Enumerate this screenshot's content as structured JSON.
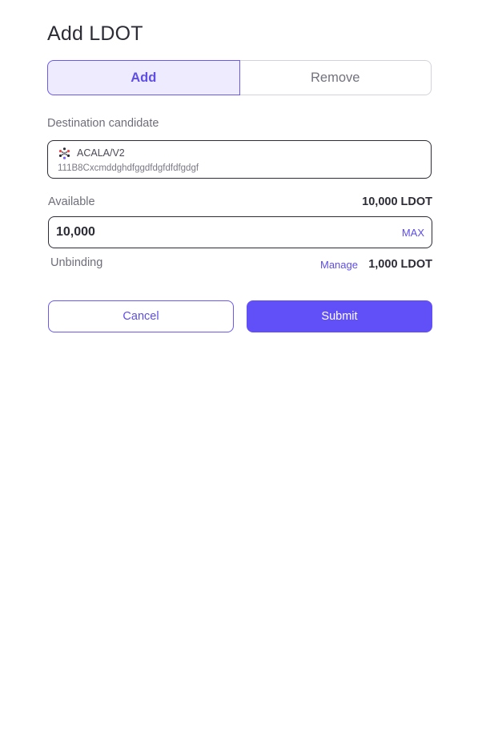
{
  "page": {
    "title": "Add LDOT"
  },
  "tabs": [
    {
      "label": "Add",
      "active": true
    },
    {
      "label": "Remove",
      "active": false
    }
  ],
  "destination": {
    "label": "Destination candidate",
    "icon": "acala-logo-icon",
    "name": "ACALA/V2",
    "address": "111B8Cxcmddghdfggdfdgfdfdfgdgf"
  },
  "available": {
    "label": "Available",
    "value": "10,000 LDOT"
  },
  "amount": {
    "value": "10,000",
    "max_label": "MAX"
  },
  "unbinding": {
    "label": "Unbinding",
    "manage_label": "Manage",
    "value": "1,000 LDOT"
  },
  "actions": {
    "cancel_label": "Cancel",
    "submit_label": "Submit"
  },
  "colors": {
    "accent": "#6150F7",
    "accent_light": "#EEEBFF",
    "text": "#2C2C36",
    "muted": "#6E6E7A"
  }
}
